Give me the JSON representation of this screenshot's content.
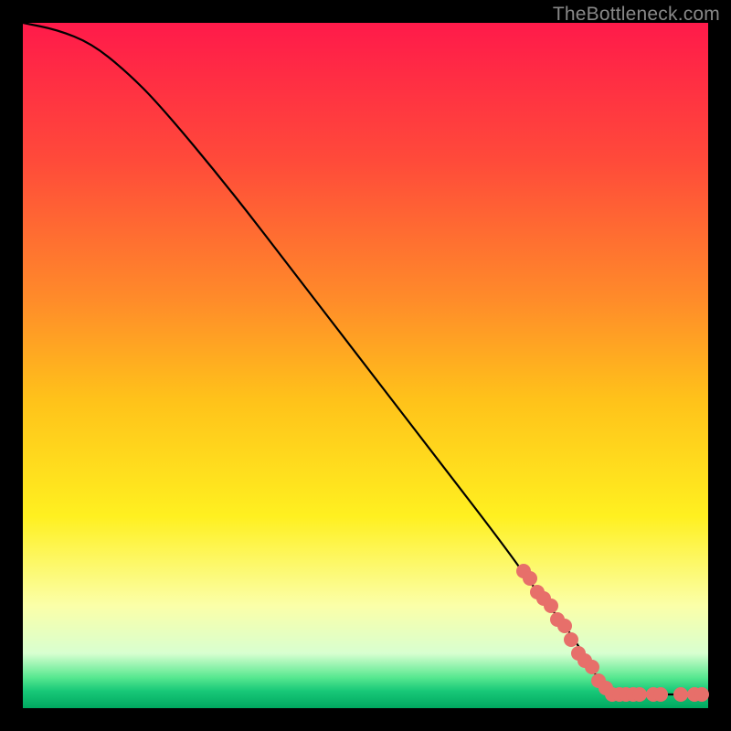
{
  "watermark": "TheBottleneck.com",
  "chart_data": {
    "type": "line",
    "title": "",
    "xlabel": "",
    "ylabel": "",
    "xlim": [
      0,
      100
    ],
    "ylim": [
      0,
      100
    ],
    "curve": [
      {
        "x": 0,
        "y": 100
      },
      {
        "x": 5,
        "y": 99
      },
      {
        "x": 10,
        "y": 97
      },
      {
        "x": 15,
        "y": 93
      },
      {
        "x": 20,
        "y": 88
      },
      {
        "x": 30,
        "y": 76
      },
      {
        "x": 40,
        "y": 63
      },
      {
        "x": 50,
        "y": 50
      },
      {
        "x": 60,
        "y": 37
      },
      {
        "x": 70,
        "y": 24
      },
      {
        "x": 75,
        "y": 17
      },
      {
        "x": 80,
        "y": 11
      },
      {
        "x": 84,
        "y": 4
      },
      {
        "x": 86,
        "y": 2
      },
      {
        "x": 88,
        "y": 2
      },
      {
        "x": 92,
        "y": 2
      },
      {
        "x": 96,
        "y": 2
      },
      {
        "x": 100,
        "y": 2
      }
    ],
    "points": [
      {
        "x": 73,
        "y": 20
      },
      {
        "x": 74,
        "y": 19
      },
      {
        "x": 75,
        "y": 17
      },
      {
        "x": 76,
        "y": 16
      },
      {
        "x": 77,
        "y": 15
      },
      {
        "x": 78,
        "y": 13
      },
      {
        "x": 79,
        "y": 12
      },
      {
        "x": 80,
        "y": 10
      },
      {
        "x": 81,
        "y": 8
      },
      {
        "x": 82,
        "y": 7
      },
      {
        "x": 83,
        "y": 6
      },
      {
        "x": 84,
        "y": 4
      },
      {
        "x": 85,
        "y": 3
      },
      {
        "x": 86,
        "y": 2
      },
      {
        "x": 87,
        "y": 2
      },
      {
        "x": 88,
        "y": 2
      },
      {
        "x": 89,
        "y": 2
      },
      {
        "x": 90,
        "y": 2
      },
      {
        "x": 92,
        "y": 2
      },
      {
        "x": 93,
        "y": 2
      },
      {
        "x": 96,
        "y": 2
      },
      {
        "x": 98,
        "y": 2
      },
      {
        "x": 99,
        "y": 2
      }
    ],
    "gradient_stops": [
      {
        "offset": 0.0,
        "color": "#ff1a4a"
      },
      {
        "offset": 0.2,
        "color": "#ff4a3a"
      },
      {
        "offset": 0.4,
        "color": "#ff8a2a"
      },
      {
        "offset": 0.55,
        "color": "#ffc21a"
      },
      {
        "offset": 0.72,
        "color": "#fff020"
      },
      {
        "offset": 0.85,
        "color": "#fbffa8"
      },
      {
        "offset": 0.92,
        "color": "#d8ffd0"
      },
      {
        "offset": 0.955,
        "color": "#58e890"
      },
      {
        "offset": 0.975,
        "color": "#18c878"
      },
      {
        "offset": 1.0,
        "color": "#00a860"
      }
    ]
  }
}
